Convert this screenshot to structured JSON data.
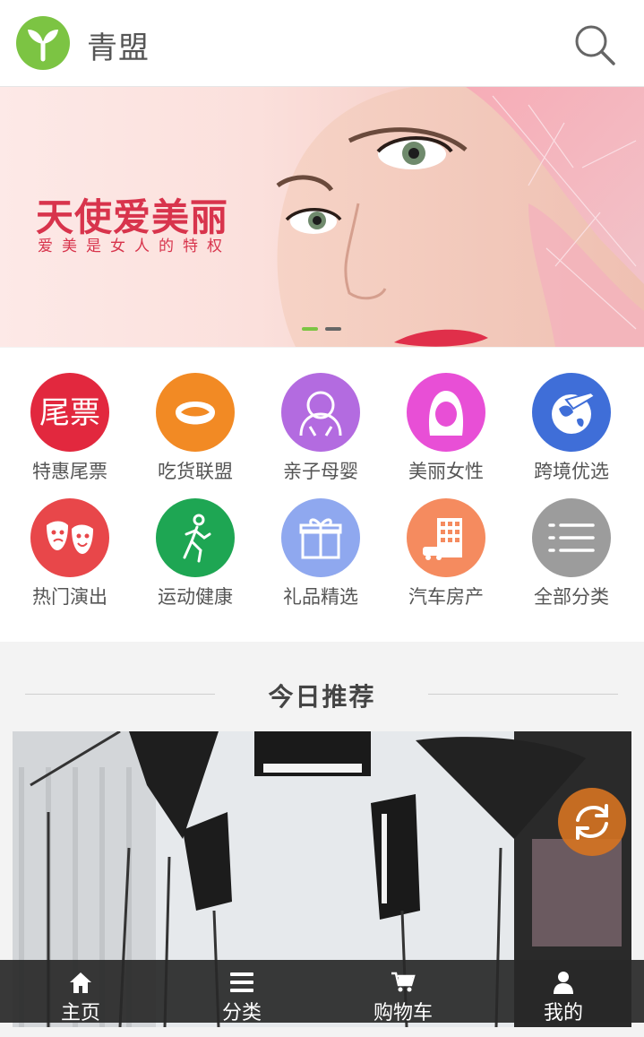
{
  "header": {
    "brand": "青盟",
    "logo_icon": "leaf-logo-icon",
    "search_icon": "search-icon"
  },
  "banner": {
    "title": "天使爱美丽",
    "subtitle": "爱美是女人的特权",
    "slides_total": 2,
    "active_slide": 1,
    "colors": {
      "title": "#d8344c",
      "active_dot": "#7cc443",
      "inactive_dot": "#666666"
    }
  },
  "categories": [
    {
      "label": "特惠尾票",
      "icon": "ticket-icon",
      "color": "#e2283e",
      "glyph": "尾票"
    },
    {
      "label": "吃货联盟",
      "icon": "food-icon",
      "color": "#f28a24"
    },
    {
      "label": "亲子母婴",
      "icon": "parent-child-icon",
      "color": "#b36be0"
    },
    {
      "label": "美丽女性",
      "icon": "woman-icon",
      "color": "#e84fd6"
    },
    {
      "label": "跨境优选",
      "icon": "plane-globe-icon",
      "color": "#3f6ed8"
    },
    {
      "label": "热门演出",
      "icon": "theater-masks-icon",
      "color": "#e8474a"
    },
    {
      "label": "运动健康",
      "icon": "running-icon",
      "color": "#1ea653"
    },
    {
      "label": "礼品精选",
      "icon": "gift-icon",
      "color": "#8fa8ef"
    },
    {
      "label": "汽车房产",
      "icon": "building-car-icon",
      "color": "#f58b5f"
    },
    {
      "label": "全部分类",
      "icon": "list-icon",
      "color": "#9c9c9c"
    }
  ],
  "recommend": {
    "title": "今日推荐",
    "refresh_icon": "refresh-icon",
    "refresh_color": "#d67321"
  },
  "tabbar": [
    {
      "label": "主页",
      "icon": "home-icon"
    },
    {
      "label": "分类",
      "icon": "menu-icon"
    },
    {
      "label": "购物车",
      "icon": "cart-icon"
    },
    {
      "label": "我的",
      "icon": "user-icon"
    }
  ]
}
